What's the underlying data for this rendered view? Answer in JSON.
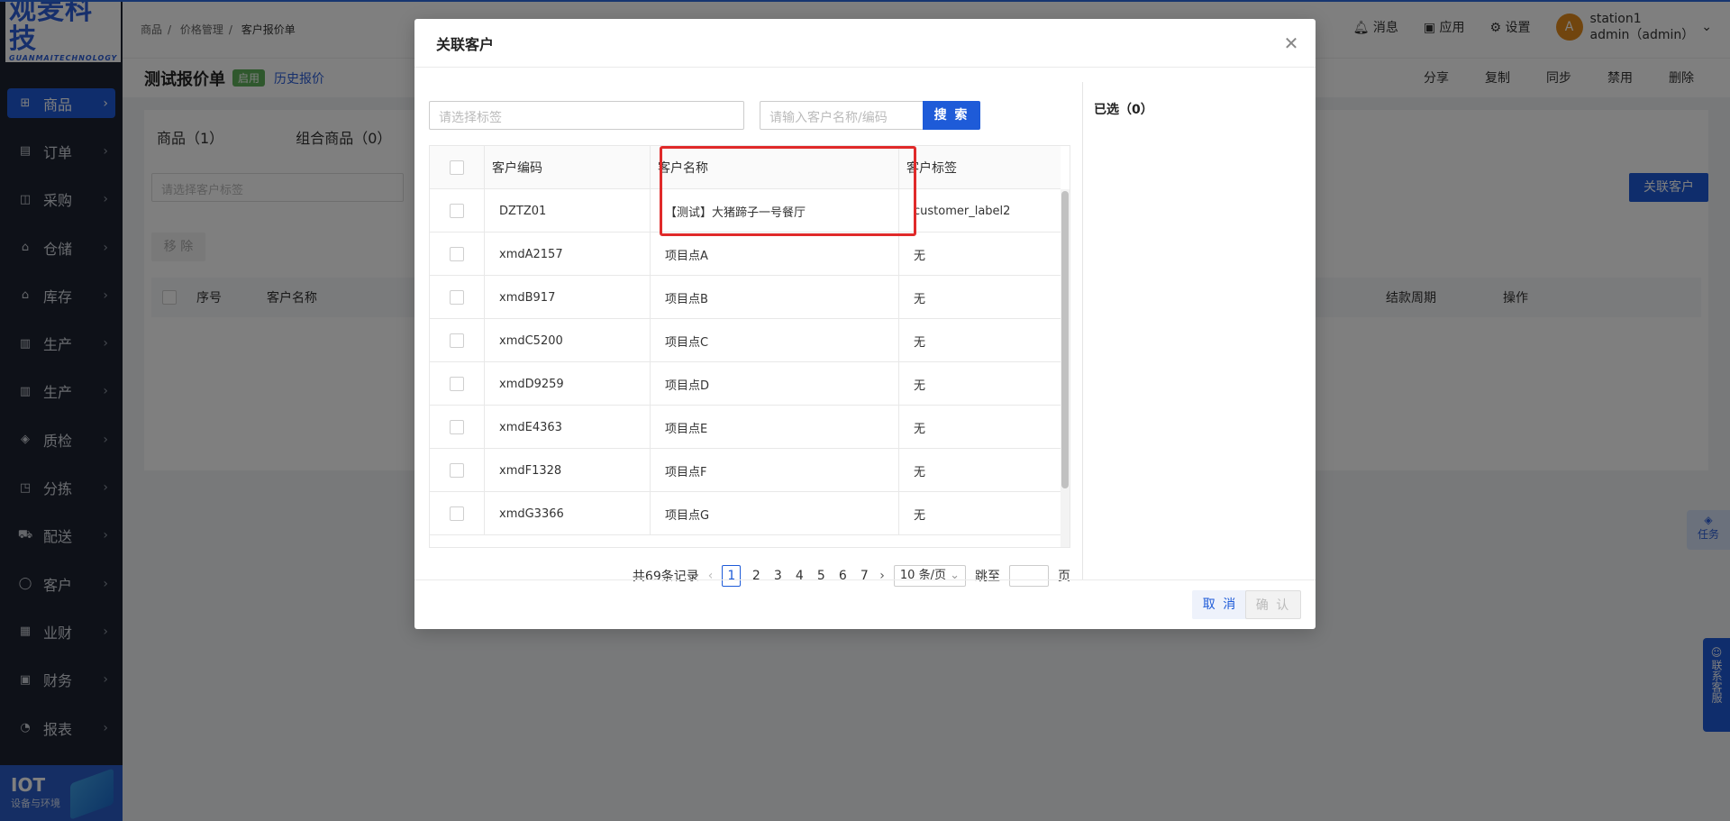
{
  "app": {
    "logo_text": "观麦科技",
    "logo_sub": "GUANMAITECHNOLOGY"
  },
  "sidebar": {
    "items": [
      {
        "label": "商品",
        "icon": "grid-icon",
        "glyph": "⊞"
      },
      {
        "label": "订单",
        "icon": "clipboard-icon",
        "glyph": "▤"
      },
      {
        "label": "采购",
        "icon": "cart-icon",
        "glyph": "◫"
      },
      {
        "label": "仓储",
        "icon": "warehouse-icon",
        "glyph": "⌂"
      },
      {
        "label": "库存",
        "icon": "stock-icon",
        "glyph": "⌂"
      },
      {
        "label": "生产",
        "icon": "factory-icon",
        "glyph": "▥"
      },
      {
        "label": "生产",
        "icon": "factory-icon",
        "glyph": "▥"
      },
      {
        "label": "质检",
        "icon": "shield-icon",
        "glyph": "◈"
      },
      {
        "label": "分拣",
        "icon": "sort-icon",
        "glyph": "◳"
      },
      {
        "label": "配送",
        "icon": "truck-icon",
        "glyph": "⛟"
      },
      {
        "label": "客户",
        "icon": "user-icon",
        "glyph": "◯"
      },
      {
        "label": "业财",
        "icon": "chart-icon",
        "glyph": "▦"
      },
      {
        "label": "财务",
        "icon": "finance-icon",
        "glyph": "▣"
      },
      {
        "label": "报表",
        "icon": "pie-icon",
        "glyph": "◔"
      }
    ],
    "iot_title": "IOT",
    "iot_sub": "设备与环境"
  },
  "topbar": {
    "breadcrumb": [
      "商品",
      "价格管理",
      "客户报价单"
    ],
    "messages": "消息",
    "apps": "应用",
    "settings": "设置",
    "user_initial": "A",
    "user_name": "station1",
    "user_role": "admin（admin）"
  },
  "page": {
    "title": "测试报价单",
    "status": "启用",
    "history_link": "历史报价",
    "actions": [
      "分享",
      "复制",
      "同步",
      "禁用",
      "删除"
    ],
    "tabs": [
      "商品（1）",
      "组合商品（0）"
    ],
    "tag_placeholder": "请选择客户标签",
    "remove": "移 除",
    "relate_customer": "关联客户",
    "columns": [
      "序号",
      "客户名称",
      "结款周期",
      "操作"
    ],
    "float_task": "任务",
    "float_contact": "联系客服"
  },
  "modal": {
    "title": "关联客户",
    "tag_placeholder": "请选择标签",
    "search_placeholder": "请输入客户名称/编码",
    "search_btn": "搜 索",
    "selected_label": "已选（0）",
    "headers": {
      "code": "客户编码",
      "name": "客户名称",
      "tag": "客户标签"
    },
    "rows": [
      {
        "code": "DZTZ01",
        "name": "【测试】大猪蹄子一号餐厅",
        "tag": "customer_label2"
      },
      {
        "code": "xmdA2157",
        "name": "项目点A",
        "tag": "无"
      },
      {
        "code": "xmdB917",
        "name": "项目点B",
        "tag": "无"
      },
      {
        "code": "xmdC5200",
        "name": "项目点C",
        "tag": "无"
      },
      {
        "code": "xmdD9259",
        "name": "项目点D",
        "tag": "无"
      },
      {
        "code": "xmdE4363",
        "name": "项目点E",
        "tag": "无"
      },
      {
        "code": "xmdF1328",
        "name": "项目点F",
        "tag": "无"
      },
      {
        "code": "xmdG3366",
        "name": "项目点G",
        "tag": "无"
      }
    ],
    "pager": {
      "total": "共69条记录",
      "pages": [
        "1",
        "2",
        "3",
        "4",
        "5",
        "6",
        "7"
      ],
      "current": "1",
      "page_size": "10 条/页",
      "jump_label": "跳至",
      "jump_unit": "页"
    },
    "cancel": "取 消",
    "confirm": "确 认"
  },
  "colors": {
    "primary": "#1e5bd8",
    "highlight": "#e02a2a",
    "sidebar_bg": "#1c2331"
  }
}
